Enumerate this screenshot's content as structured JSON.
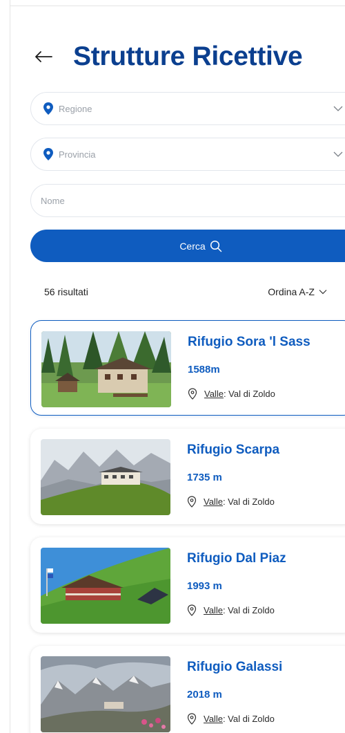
{
  "header": {
    "title": "Strutture Ricettive",
    "back_icon": "arrow-left-icon"
  },
  "filters": {
    "regione_placeholder": "Regione",
    "provincia_placeholder": "Provincia",
    "nome_placeholder": "Nome",
    "search_label": "Cerca"
  },
  "results": {
    "count_label": "56 risultati",
    "sort_label": "Ordina A-Z"
  },
  "cards": [
    {
      "name": "Rifugio Sora 'l Sass",
      "altitude": "1588m",
      "location_key": "Valle",
      "location_value": ": Val di Zoldo"
    },
    {
      "name": "Rifugio Scarpa",
      "altitude": "1735 m",
      "location_key": "Valle",
      "location_value": ": Val di Zoldo"
    },
    {
      "name": "Rifugio Dal Piaz",
      "altitude": "1993 m",
      "location_key": "Valle",
      "location_value": ": Val di Zoldo"
    },
    {
      "name": "Rifugio Galassi",
      "altitude": "2018 m",
      "location_key": "Valle",
      "location_value": ": Val di Zoldo"
    }
  ],
  "colors": {
    "title": "#0b3f8f",
    "accent": "#0f5cbf",
    "border": "#e2e6ec"
  }
}
